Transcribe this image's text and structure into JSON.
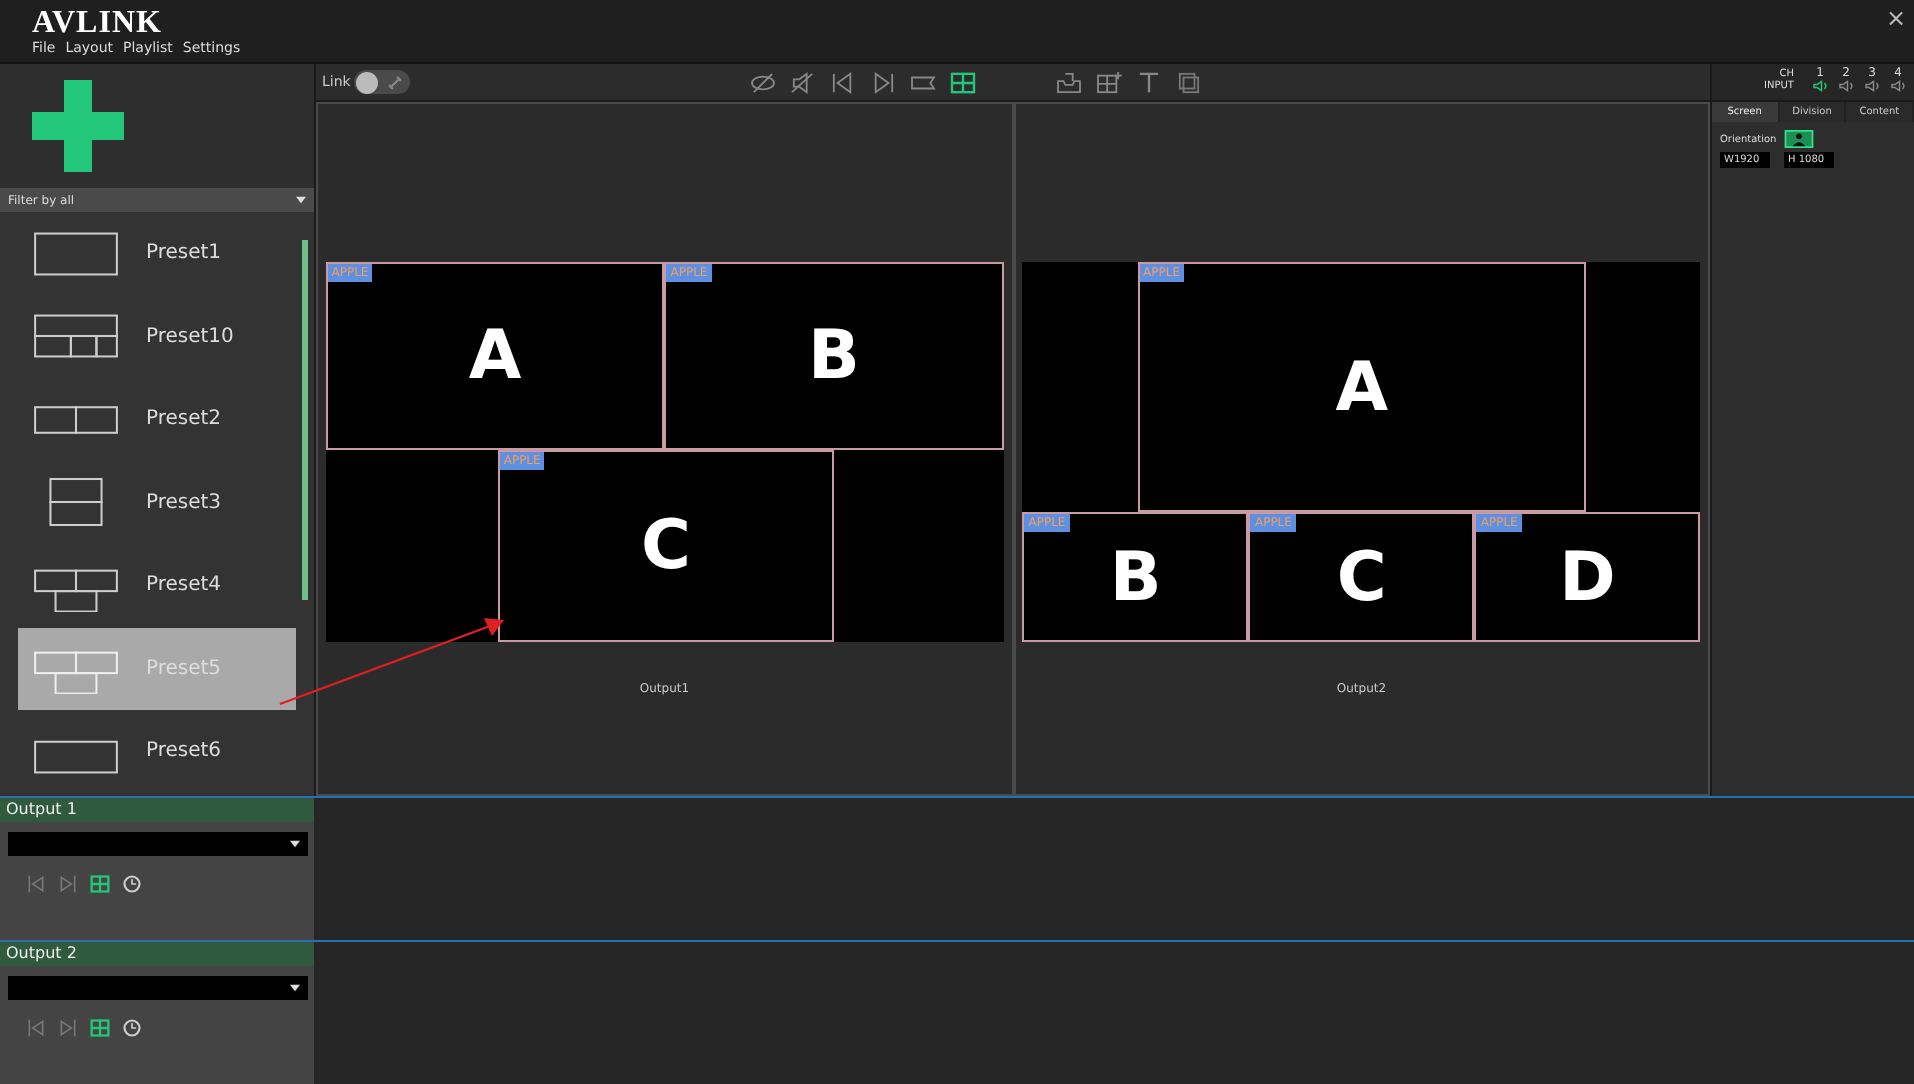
{
  "app": {
    "logo": "AVLINK",
    "menu": [
      "File",
      "Layout",
      "Playlist",
      "Settings"
    ],
    "close": "×"
  },
  "sidebar": {
    "filter": "Filter by all",
    "presets": [
      {
        "label": "Preset1",
        "selected": false
      },
      {
        "label": "Preset10",
        "selected": false
      },
      {
        "label": "Preset2",
        "selected": false
      },
      {
        "label": "Preset3",
        "selected": false
      },
      {
        "label": "Preset4",
        "selected": false
      },
      {
        "label": "Preset5",
        "selected": true
      },
      {
        "label": "Preset6",
        "selected": false
      }
    ]
  },
  "toolbar": {
    "link_label": "Link",
    "link_on": false
  },
  "outputs": [
    {
      "name": "Output1",
      "windows": [
        {
          "source": "APPLE",
          "letter": "A"
        },
        {
          "source": "APPLE",
          "letter": "B"
        },
        {
          "source": "APPLE",
          "letter": "C"
        }
      ]
    },
    {
      "name": "Output2",
      "windows": [
        {
          "source": "APPLE",
          "letter": "A"
        },
        {
          "source": "APPLE",
          "letter": "B"
        },
        {
          "source": "APPLE",
          "letter": "C"
        },
        {
          "source": "APPLE",
          "letter": "D"
        }
      ]
    }
  ],
  "inputs": {
    "ch_label": "CH",
    "input_label": "INPUT",
    "channels": [
      {
        "number": "1",
        "active": true
      },
      {
        "number": "2",
        "active": false
      },
      {
        "number": "3",
        "active": false
      },
      {
        "number": "4",
        "active": false
      }
    ]
  },
  "panel_tabs": [
    {
      "label": "Screen",
      "selected": true
    },
    {
      "label": "Division",
      "selected": false
    },
    {
      "label": "Content",
      "selected": false
    }
  ],
  "screen": {
    "orientation_label": "Orientation",
    "width": "W1920",
    "height": "H 1080"
  },
  "output_controls": [
    {
      "title": "Output 1"
    },
    {
      "title": "Output 2"
    }
  ]
}
